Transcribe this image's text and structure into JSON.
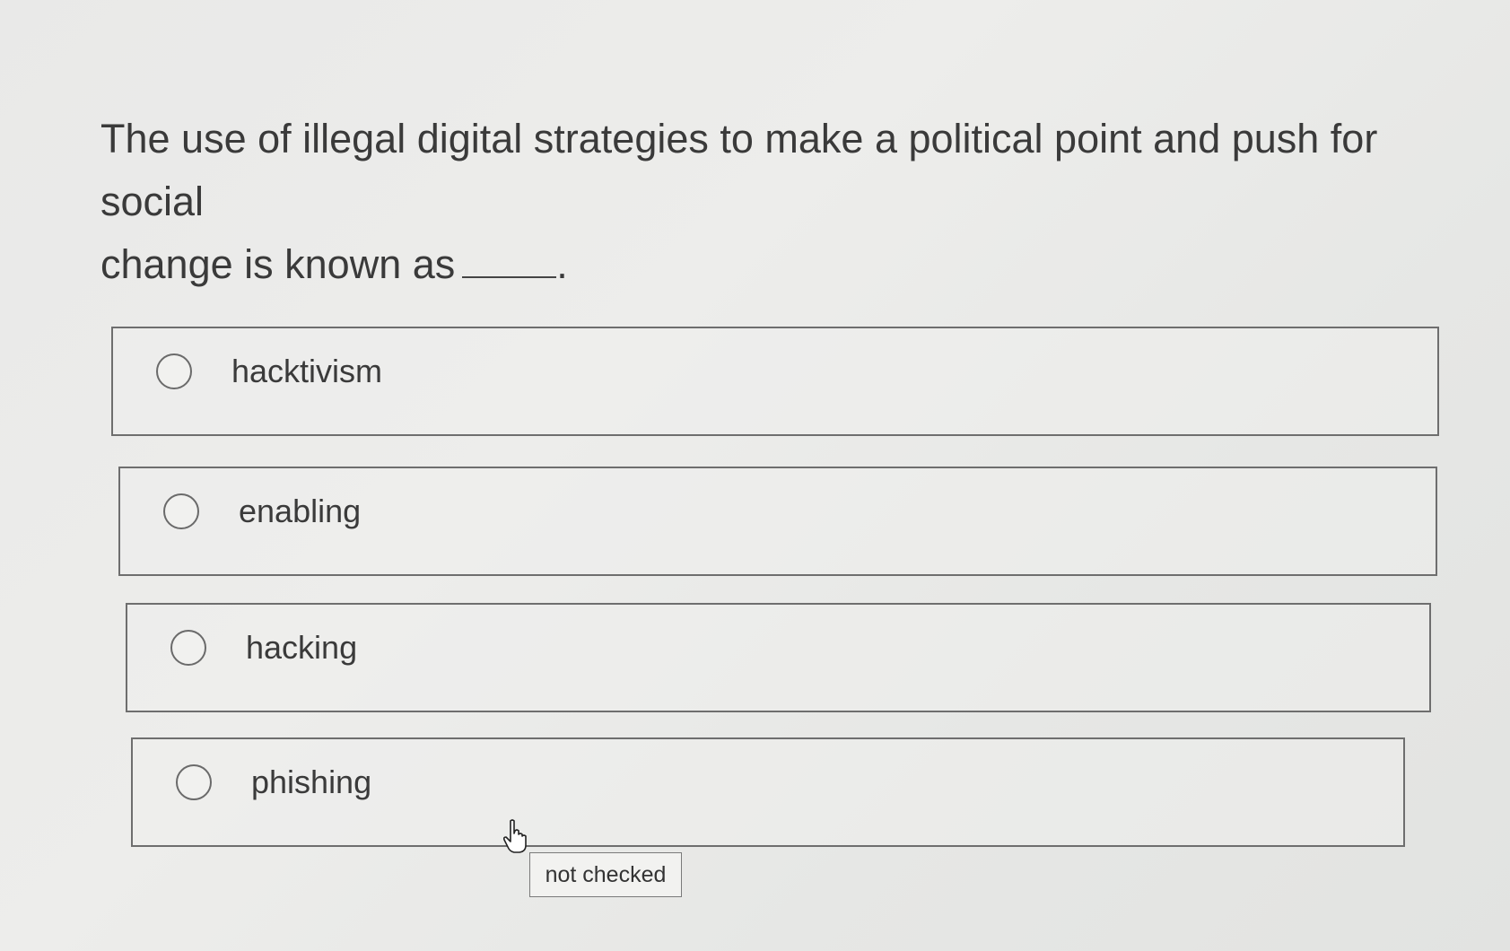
{
  "question": {
    "line1": "The use of illegal digital strategies to make a political point and push for social",
    "line2": "change is known as",
    "trailing_period": "."
  },
  "options": [
    {
      "label": "hacktivism",
      "checked": false
    },
    {
      "label": "enabling",
      "checked": false
    },
    {
      "label": "hacking",
      "checked": false
    },
    {
      "label": "phishing",
      "checked": false
    }
  ],
  "tooltip": {
    "text": "not checked"
  },
  "icons": {
    "radio": "radio-unchecked-icon",
    "cursor": "hand-pointer-icon"
  }
}
